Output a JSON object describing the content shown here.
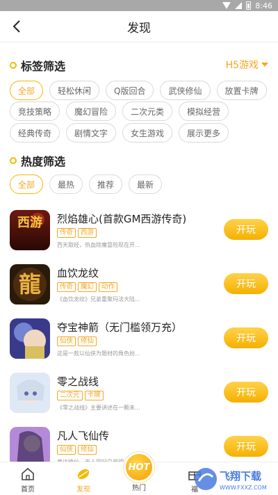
{
  "status_bar": {
    "time": "8:46"
  },
  "header": {
    "title": "发现"
  },
  "tag_filter": {
    "title": "标签筛选",
    "platform": "H5游戏",
    "rows": [
      [
        {
          "label": "全部",
          "active": true
        },
        {
          "label": "轻松休闲"
        },
        {
          "label": "Q版回合"
        },
        {
          "label": "武侠修仙"
        },
        {
          "label": "放置卡牌"
        }
      ],
      [
        {
          "label": "竞技策略"
        },
        {
          "label": "魔幻冒险"
        },
        {
          "label": "二次元类"
        },
        {
          "label": "模拟经营"
        }
      ],
      [
        {
          "label": "经典传奇"
        },
        {
          "label": "剧情文字"
        },
        {
          "label": "女生游戏"
        },
        {
          "label": "展示更多"
        }
      ]
    ]
  },
  "heat_filter": {
    "title": "热度筛选",
    "options": [
      {
        "label": "全部",
        "active": true
      },
      {
        "label": "最热"
      },
      {
        "label": "推荐"
      },
      {
        "label": "最新"
      }
    ]
  },
  "games": [
    {
      "name": "烈焰雄心(首款GM西游传奇)",
      "tags": [
        "传奇",
        "西游"
      ],
      "desc": "西天取经，热血除魔冒险现在开...",
      "button": "开玩",
      "thumb_text": "西游"
    },
    {
      "name": "血饮龙纹",
      "tags": [
        "传奇",
        "魔幻",
        "动作"
      ],
      "desc": "《血饮龙纹》兄弟重聚玛法大陆...",
      "button": "开玩",
      "thumb_text": "龍"
    },
    {
      "name": "夺宝神箭（无门槛领万充）",
      "tags": [
        "仙侠",
        "修仙"
      ],
      "desc": "这是一款以仙侠为题材的角色扮...",
      "button": "开玩",
      "thumb_text": ""
    },
    {
      "name": "零之战线",
      "tags": [
        "二次元",
        "卡牌"
      ],
      "desc": "《零之战线》主要讲述在一颗未...",
      "button": "开玩",
      "thumb_text": ""
    },
    {
      "name": "凡人飞仙传",
      "tags": [
        "仙侠",
        "修仙"
      ],
      "desc": "竟达修仙，天人同归白忠明",
      "button": "开玩",
      "thumb_text": ""
    }
  ],
  "tabbar": {
    "items": [
      {
        "label": "首页"
      },
      {
        "label": "发现",
        "active": true
      },
      {
        "label": "热门",
        "badge": "HOT"
      },
      {
        "label": "福"
      }
    ]
  },
  "watermark": {
    "text": "飞翔下载",
    "url": "WWW.FXXZ.COM"
  },
  "colors": {
    "accent": "#f5a623",
    "button": "#f5b800"
  }
}
